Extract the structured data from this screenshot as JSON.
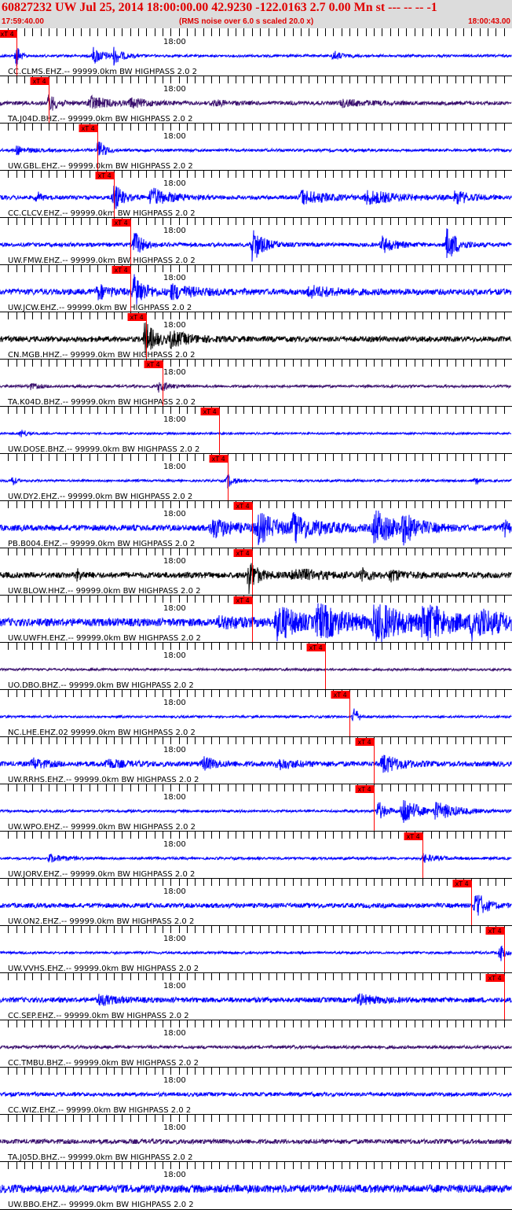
{
  "header": {
    "title": "60827232 UW Jul 25, 2014 18:00:00.00   42.9230 -122.0163  2.7 0.00 Mn st --- -- --  -1",
    "start_time": "17:59:40.00",
    "note": "(RMS noise over 6.0 s scaled 20.0 x)",
    "end_time": "18:00:43.00"
  },
  "chart_data": {
    "type": "line",
    "x_unit": "seconds after 17:59:40.00",
    "xlim": [
      0,
      63
    ],
    "tick_label": "18:00",
    "tick_label_time": 20,
    "pick_label": "xT 4",
    "colors": {
      "blue": "#0000ff",
      "purple": "#3a106e",
      "black": "#000000",
      "pick": "#ff0000"
    },
    "traces": [
      {
        "label": "CC.CLMS.EHZ.-- 99999.0km BW  HIGHPASS  2.0  2",
        "pick": 2.0,
        "noise": 0.06,
        "color": "blue",
        "bursts": [
          [
            2.0,
            0.75,
            0.4
          ],
          [
            11.5,
            0.4,
            1.5
          ],
          [
            14.0,
            0.35,
            1.0
          ],
          [
            41.0,
            0.25,
            1.0
          ]
        ]
      },
      {
        "label": "TA.J04D.BHZ.-- 99999.0km BW  HIGHPASS  2.0  2",
        "pick": 6.0,
        "noise": 0.1,
        "color": "purple",
        "bursts": [
          [
            6.0,
            0.45,
            1.0
          ],
          [
            11.0,
            0.35,
            2.0
          ],
          [
            16.0,
            0.2,
            2.0
          ],
          [
            26.0,
            0.12,
            2.0
          ],
          [
            42.0,
            0.15,
            3.0
          ]
        ]
      },
      {
        "label": "UW.GBL.EHZ.-- 99999.0km BW  HIGHPASS  2.0  2",
        "pick": 12.0,
        "noise": 0.07,
        "color": "blue",
        "bursts": [
          [
            2.0,
            0.2,
            1.5
          ],
          [
            12.0,
            0.55,
            0.8
          ]
        ]
      },
      {
        "label": "CC.CLCV.EHZ.-- 99999.0km BW  HIGHPASS  2.0  2",
        "pick": 14.0,
        "noise": 0.1,
        "color": "blue",
        "bursts": [
          [
            4.5,
            0.3,
            0.5
          ],
          [
            14.0,
            0.7,
            1.0
          ],
          [
            18.5,
            0.45,
            2.5
          ],
          [
            37.0,
            0.35,
            3.0
          ],
          [
            45.0,
            0.3,
            4.0
          ],
          [
            56.0,
            0.35,
            1.5
          ]
        ]
      },
      {
        "label": "UW.FMW.EHZ.-- 99999.0km BW  HIGHPASS  2.0  2",
        "pick": 16.0,
        "noise": 0.1,
        "color": "blue",
        "bursts": [
          [
            16.5,
            0.65,
            1.0
          ],
          [
            31.0,
            0.9,
            1.2
          ],
          [
            47.0,
            0.4,
            1.5
          ],
          [
            55.0,
            0.85,
            1.2
          ]
        ]
      },
      {
        "label": "UW.JCW.EHZ.-- 99999.0km BW  HIGHPASS  2.0  2",
        "pick": 16.0,
        "noise": 0.15,
        "color": "blue",
        "bursts": [
          [
            12.0,
            0.35,
            1.5
          ],
          [
            16.5,
            0.9,
            1.2
          ],
          [
            21.0,
            0.3,
            3.0
          ],
          [
            38.0,
            0.25,
            3.0
          ]
        ]
      },
      {
        "label": "CN.MGB.HHZ.-- 99999.0km BW  HIGHPASS  2.0  2",
        "pick": 18.0,
        "noise": 0.14,
        "color": "black",
        "bursts": [
          [
            17.8,
            0.85,
            1.2
          ],
          [
            21.0,
            0.3,
            2.5
          ]
        ]
      },
      {
        "label": "TA.K04D.BHZ.-- 99999.0km BW  HIGHPASS  2.0  2",
        "pick": 20.0,
        "noise": 0.06,
        "color": "purple",
        "bursts": [
          [
            3.5,
            0.15,
            1.5
          ],
          [
            19.5,
            0.3,
            1.2
          ]
        ]
      },
      {
        "label": "UW.DOSE.BHZ.-- 99999.0km BW  HIGHPASS  2.0  2",
        "pick": 27.0,
        "noise": 0.04,
        "color": "blue",
        "bursts": [
          [
            2.5,
            0.25,
            0.8
          ]
        ]
      },
      {
        "label": "UW.DY2.EHZ.-- 99999.0km BW  HIGHPASS  2.0  2",
        "pick": 28.0,
        "noise": 0.05,
        "color": "blue",
        "bursts": [
          [
            1.5,
            0.3,
            0.4
          ],
          [
            28.0,
            0.35,
            0.8
          ],
          [
            58.5,
            0.25,
            0.4
          ]
        ]
      },
      {
        "label": "PB.B004.EHZ.-- 99999.0km BW  HIGHPASS  2.0  2",
        "pick": 31.0,
        "noise": 0.15,
        "color": "blue",
        "bursts": [
          [
            26.0,
            0.5,
            2.5
          ],
          [
            31.5,
            0.75,
            2.5
          ],
          [
            36.0,
            0.55,
            3.5
          ],
          [
            46.0,
            0.85,
            2.5
          ],
          [
            49.5,
            0.55,
            2.0
          ],
          [
            62.0,
            0.4,
            0.6
          ]
        ]
      },
      {
        "label": "UW.BLOW.HHZ.-- 99999.0km BW  HIGHPASS  2.0  2",
        "pick": 31.0,
        "noise": 0.15,
        "color": "black",
        "bursts": [
          [
            9.5,
            0.25,
            0.6
          ],
          [
            30.5,
            0.9,
            1.0
          ],
          [
            36.0,
            0.3,
            3.0
          ],
          [
            44.5,
            0.3,
            1.0
          ],
          [
            48.0,
            0.25,
            1.5
          ]
        ]
      },
      {
        "label": "UW.UWFH.EHZ.-- 99999.0km BW  HIGHPASS  2.0  2",
        "pick": 31.0,
        "noise": 0.2,
        "color": "blue",
        "bursts": [
          [
            27.0,
            0.25,
            3.0
          ],
          [
            34.0,
            0.95,
            2.5
          ],
          [
            39.0,
            0.75,
            4.0
          ],
          [
            46.0,
            0.9,
            3.5
          ],
          [
            52.0,
            0.9,
            3.0
          ],
          [
            58.0,
            0.7,
            4.0
          ]
        ]
      },
      {
        "label": "UO.DBO.BHZ.-- 99999.0km BW  HIGHPASS  2.0  2",
        "pick": 40.0,
        "noise": 0.05,
        "color": "purple",
        "bursts": []
      },
      {
        "label": "NC.LHE.EHZ.02 99999.0km BW  HIGHPASS  2.0  2",
        "pick": 43.0,
        "noise": 0.05,
        "color": "blue",
        "bursts": [
          [
            43.5,
            0.6,
            0.5
          ]
        ]
      },
      {
        "label": "UW.RRHS.EHZ.-- 99999.0km BW  HIGHPASS  2.0  2",
        "pick": 46.0,
        "noise": 0.13,
        "color": "blue",
        "bursts": [
          [
            4.0,
            0.25,
            1.5
          ],
          [
            13.0,
            0.2,
            2.0
          ],
          [
            25.0,
            0.3,
            1.5
          ],
          [
            34.0,
            0.25,
            2.0
          ],
          [
            47.0,
            0.45,
            2.0
          ]
        ]
      },
      {
        "label": "UW.WPO.EHZ.-- 99999.0km BW  HIGHPASS  2.0  2",
        "pick": 46.0,
        "noise": 0.06,
        "color": "blue",
        "bursts": [
          [
            46.5,
            0.5,
            1.0
          ],
          [
            49.5,
            0.85,
            1.5
          ],
          [
            53.5,
            0.4,
            3.0
          ]
        ]
      },
      {
        "label": "UW.JORV.EHZ.-- 99999.0km BW  HIGHPASS  2.0  2",
        "pick": 52.0,
        "noise": 0.06,
        "color": "blue",
        "bursts": [
          [
            6.0,
            0.2,
            2.0
          ],
          [
            52.0,
            0.2,
            2.0
          ]
        ]
      },
      {
        "label": "UW.ON2.EHZ.-- 99999.0km BW  HIGHPASS  2.0  2",
        "pick": 58.0,
        "noise": 0.12,
        "color": "blue",
        "bursts": [
          [
            58.5,
            0.8,
            1.0
          ]
        ]
      },
      {
        "label": "UW.VVHS.EHZ.-- 99999.0km BW  HIGHPASS  2.0  2",
        "pick": 62.0,
        "noise": 0.06,
        "color": "blue",
        "bursts": [
          [
            61.5,
            0.5,
            0.5
          ]
        ]
      },
      {
        "label": "CC.SEP.EHZ.-- 99999.0km BW  HIGHPASS  2.0  2",
        "pick": 62.0,
        "noise": 0.13,
        "color": "blue",
        "bursts": [
          [
            12.0,
            0.25,
            2.0
          ],
          [
            44.0,
            0.25,
            2.0
          ]
        ]
      },
      {
        "label": "CC.TMBU.BHZ.-- 99999.0km BW  HIGHPASS  2.0  2",
        "pick": null,
        "noise": 0.08,
        "color": "purple",
        "bursts": []
      },
      {
        "label": "CC.WIZ.EHZ.-- 99999.0km BW  HIGHPASS  2.0  2",
        "pick": null,
        "noise": 0.1,
        "color": "blue",
        "bursts": []
      },
      {
        "label": "TA.J05D.BHZ.-- 99999.0km BW  HIGHPASS  2.0  2",
        "pick": null,
        "noise": 0.12,
        "color": "purple",
        "bursts": []
      },
      {
        "label": "UW.BBO.EHZ.-- 99999.0km BW  HIGHPASS  2.0  2",
        "pick": null,
        "noise": 0.2,
        "color": "blue",
        "bursts": []
      }
    ]
  }
}
